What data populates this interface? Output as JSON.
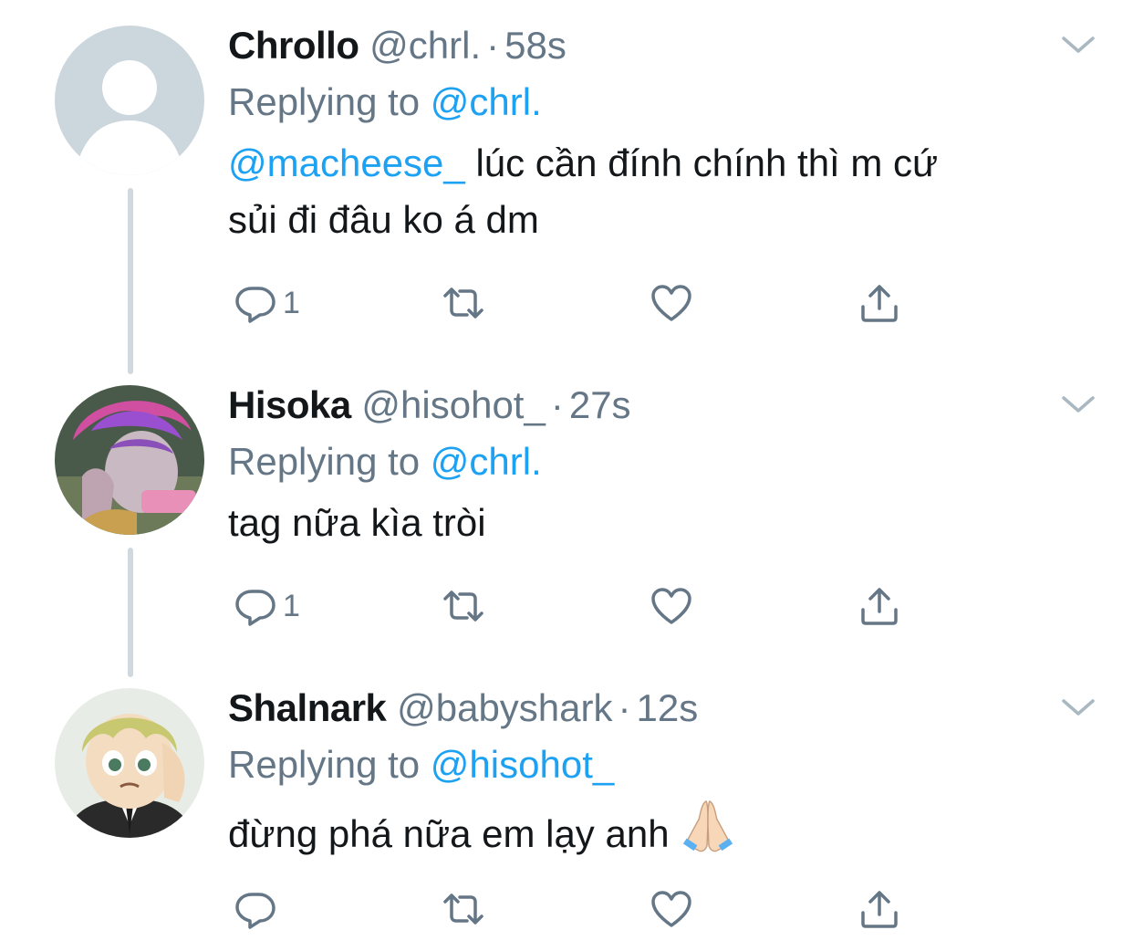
{
  "colors": {
    "link": "#1da1f2",
    "muted": "#657786",
    "text": "#14171a",
    "thread_line": "#cfd9de"
  },
  "tweets": [
    {
      "display_name": "Chrollo",
      "handle": "@chrl.",
      "dot": "·",
      "time": "58s",
      "replying_prefix": "Replying to",
      "replying_to": "@chrl.",
      "mention": "@macheese_",
      "text_line1": " lúc cần đính chính thì m cứ",
      "text_line2": "sủi đi đâu ko á dm",
      "reply_count": "1",
      "avatar": "default-avatar-icon"
    },
    {
      "display_name": "Hisoka",
      "handle": "@hisohot_",
      "dot": "·",
      "time": "27s",
      "replying_prefix": "Replying to",
      "replying_to": "@chrl.",
      "text_line1": "tag nữa kìa tròi",
      "reply_count": "1",
      "avatar": "hisoka-avatar"
    },
    {
      "display_name": "Shalnark",
      "handle": "@babyshark",
      "dot": "·",
      "time": "12s",
      "replying_prefix": "Replying to",
      "replying_to": "@hisohot_",
      "text_line1": "đừng phá nữa em lạy anh",
      "emoji": "folded-hands-emoji",
      "reply_count": "",
      "avatar": "shalnark-avatar"
    }
  ],
  "icons": {
    "reply": "reply-icon",
    "retweet": "retweet-icon",
    "like": "heart-icon",
    "share": "share-icon",
    "caret": "chevron-down-icon"
  }
}
